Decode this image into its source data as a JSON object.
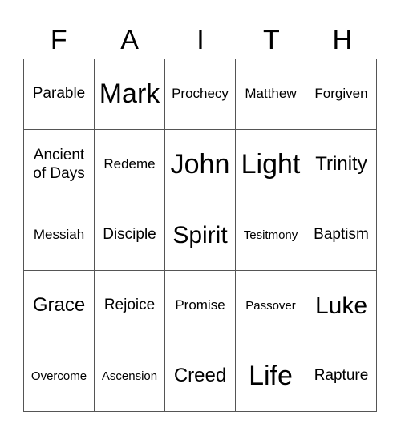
{
  "title_letters": [
    "F",
    "A",
    "I",
    "T",
    "H"
  ],
  "cells": [
    [
      "Parable",
      "Mark",
      "Prochecy",
      "Matthew",
      "Forgiven"
    ],
    [
      "Ancient of Days",
      "Redeme",
      "John",
      "Light",
      "Trinity"
    ],
    [
      "Messiah",
      "Disciple",
      "Spirit",
      "Tesitmony",
      "Baptism"
    ],
    [
      "Grace",
      "Rejoice",
      "Promise",
      "Passover",
      "Luke"
    ],
    [
      "Overcome",
      "Ascension",
      "Creed",
      "Life",
      "Rapture"
    ]
  ]
}
